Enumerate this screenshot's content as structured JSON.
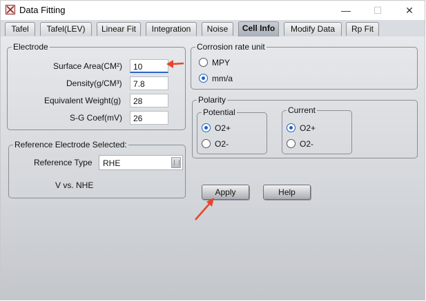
{
  "window": {
    "title": "Data Fitting",
    "buttons": {
      "minimize": "—",
      "maximize": "☐",
      "close": "✕"
    }
  },
  "tabs": [
    {
      "label": "Tafel",
      "active": false
    },
    {
      "label": "Tafel(LEV)",
      "active": false
    },
    {
      "label": "Linear Fit",
      "active": false
    },
    {
      "label": "Integration",
      "active": false
    },
    {
      "label": "Noise",
      "active": false
    },
    {
      "label": "Cell Info",
      "active": true
    },
    {
      "label": "Modify Data",
      "active": false
    },
    {
      "label": "Rp Fit",
      "active": false
    }
  ],
  "electrode": {
    "legend": "Electrode",
    "fields": [
      {
        "label": "Surface Area(CM²)",
        "value": "10"
      },
      {
        "label": "Density(g/CM³)",
        "value": "7.8"
      },
      {
        "label": "Equivalent Weight(g)",
        "value": "28"
      },
      {
        "label": "S-G Coef(mV)",
        "value": "26"
      }
    ]
  },
  "reference": {
    "legend": "Reference Electrode Selected:",
    "type_label": "Reference Type",
    "type_value": "RHE",
    "vs_text": "V vs. NHE"
  },
  "corrosion": {
    "legend": "Corrosion rate unit",
    "options": [
      {
        "label": "MPY",
        "selected": false
      },
      {
        "label": "mm/a",
        "selected": true
      }
    ]
  },
  "polarity": {
    "legend": "Polarity",
    "potential": {
      "legend": "Potential",
      "options": [
        {
          "label": "O2+",
          "selected": true
        },
        {
          "label": "O2-",
          "selected": false
        }
      ]
    },
    "current": {
      "legend": "Current",
      "options": [
        {
          "label": "O2+",
          "selected": true
        },
        {
          "label": "O2-",
          "selected": false
        }
      ]
    }
  },
  "actions": {
    "apply": "Apply",
    "help": "Help"
  },
  "colors": {
    "annotation_arrow": "#e8442a",
    "selected_radio": "#1f5fbf",
    "active_tab": "#b3b8c0"
  }
}
